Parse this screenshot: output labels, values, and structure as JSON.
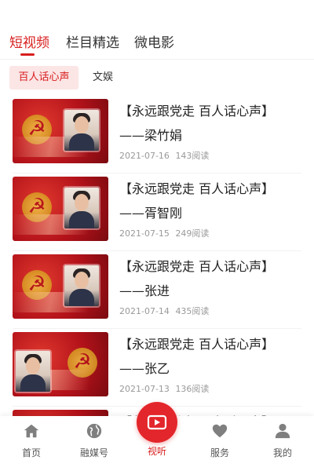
{
  "top_tabs": [
    {
      "label": "短视频",
      "active": true
    },
    {
      "label": "栏目精选",
      "active": false
    },
    {
      "label": "微电影",
      "active": false
    }
  ],
  "sub_tabs": [
    {
      "label": "百人话心声",
      "active": true
    },
    {
      "label": "文娱",
      "active": false
    }
  ],
  "videos": [
    {
      "title_line1": "【永远跟党走 百人话心声】",
      "title_line2": "——梁竹娟",
      "date": "2021-07-16",
      "reads": "143阅读"
    },
    {
      "title_line1": "【永远跟党走 百人话心声】",
      "title_line2": "——胥智刚",
      "date": "2021-07-15",
      "reads": "249阅读"
    },
    {
      "title_line1": "【永远跟党走 百人话心声】",
      "title_line2": "——张进",
      "date": "2021-07-14",
      "reads": "435阅读"
    },
    {
      "title_line1": "【永远跟党走 百人话心声】",
      "title_line2": "——张乙",
      "date": "2021-07-13",
      "reads": "136阅读"
    },
    {
      "title_line1": "【永远跟党走 百人话心声】",
      "title_line2": "",
      "date": "",
      "reads": ""
    }
  ],
  "bottom_nav": [
    {
      "label": "首页",
      "icon": "home-icon"
    },
    {
      "label": "融媒号",
      "icon": "globe-icon"
    },
    {
      "label": "视听",
      "icon": "video-icon",
      "active": true
    },
    {
      "label": "服务",
      "icon": "heart-icon"
    },
    {
      "label": "我的",
      "icon": "user-icon"
    }
  ],
  "colors": {
    "accent": "#d81e1e",
    "nav_center": "#e3262b"
  }
}
